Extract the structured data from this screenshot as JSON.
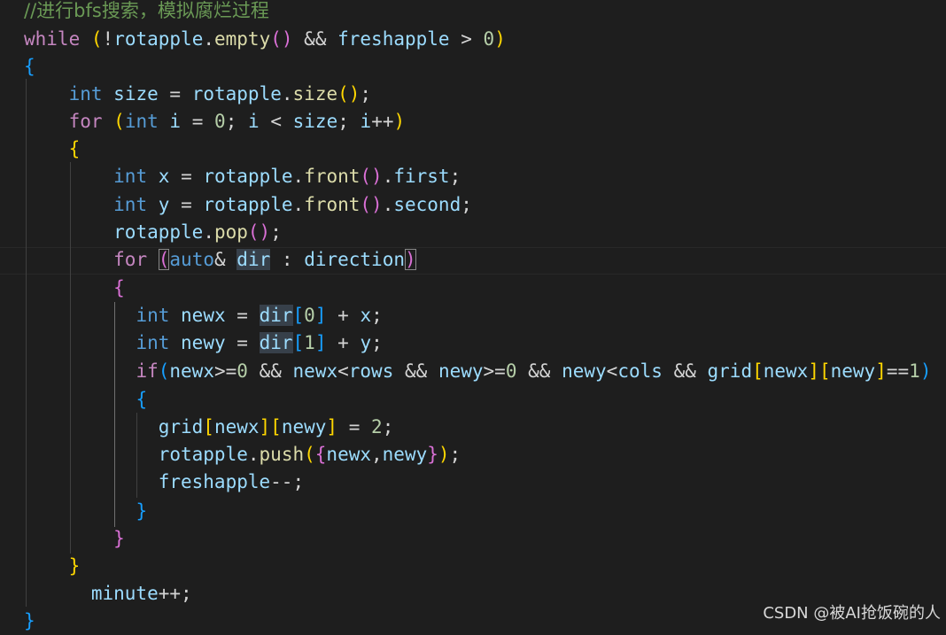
{
  "code": {
    "comment": "//进行bfs搜索，模拟腐烂过程",
    "kw_while": "while",
    "kw_for": "for",
    "kw_int": "int",
    "kw_auto": "auto",
    "kw_if": "if",
    "var_rotapple": "rotapple",
    "var_freshapple": "freshapple",
    "var_size": "size",
    "var_i": "i",
    "var_x": "x",
    "var_y": "y",
    "var_dir": "dir",
    "var_direction": "direction",
    "var_newx": "newx",
    "var_newy": "newy",
    "var_rows": "rows",
    "var_cols": "cols",
    "var_grid": "grid",
    "var_minute": "minute",
    "fn_empty": "empty",
    "fn_size": "size",
    "fn_front": "front",
    "fn_pop": "pop",
    "fn_push": "push",
    "member_first": "first",
    "member_second": "second",
    "num_0": "0",
    "num_1": "1",
    "num_2": "2"
  },
  "watermark": "CSDN @被AI抢饭碗的人",
  "colors": {
    "background": "#1e1e1e",
    "keyword_control": "#c586c0",
    "keyword_type": "#569cd6",
    "function": "#dcdcaa",
    "variable": "#9cdcfe",
    "number": "#b5cea8",
    "comment": "#6a9955",
    "bracket_level1": "#ffd700",
    "bracket_level2": "#da70d6",
    "bracket_level3": "#179fff"
  }
}
